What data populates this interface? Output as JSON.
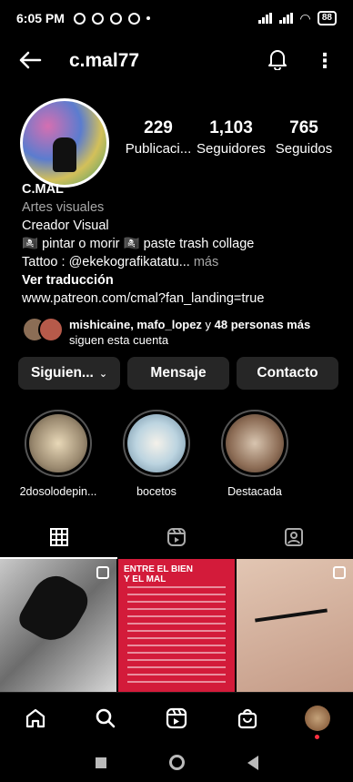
{
  "status_bar": {
    "time": "6:05 PM",
    "battery": "88"
  },
  "header": {
    "username": "c.mal77"
  },
  "profile": {
    "stats": [
      {
        "value": "229",
        "label": "Publicaci..."
      },
      {
        "value": "1,103",
        "label": "Seguidores"
      },
      {
        "value": "765",
        "label": "Seguidos"
      }
    ],
    "name": "C.MAL",
    "category": "Artes visuales",
    "bio_line1": "Creador  Visual",
    "bio_line2": "🏴‍☠️ pintar o morir 🏴‍☠️ paste trash collage",
    "bio_line3": "Tattoo : @ekekografikatatu...",
    "bio_more": " más",
    "translate": "Ver traducción",
    "link": "www.patreon.com/cmal?fan_landing=true"
  },
  "followed_by": {
    "users": "mishicaine, mafo_lopez",
    "connector": " y ",
    "others": "48 personas más",
    "suffix": " siguen esta cuenta"
  },
  "buttons": {
    "following": "Siguien...",
    "message": "Mensaje",
    "contact": "Contacto"
  },
  "highlights": [
    {
      "label": "2dosolodepin..."
    },
    {
      "label": "bocetos"
    },
    {
      "label": "Destacada"
    }
  ],
  "grid": {
    "poster_title": "ENTRE EL BIEN\nY EL MAL"
  },
  "icons": {
    "back": "back-arrow-icon",
    "bell": "bell-icon",
    "more": "kebab-icon",
    "grid": "grid-icon",
    "reels": "reels-icon",
    "tagged": "tagged-icon",
    "home": "home-icon",
    "search": "search-icon",
    "shop": "shop-icon"
  }
}
